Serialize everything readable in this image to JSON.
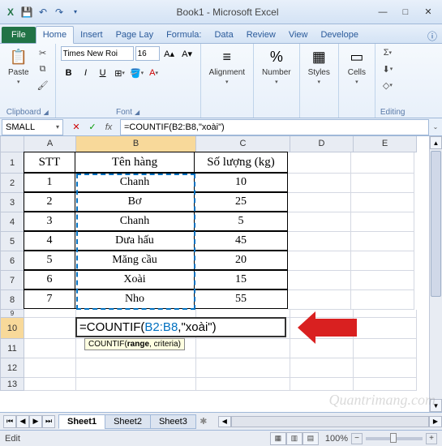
{
  "window": {
    "title": "Book1 - Microsoft Excel"
  },
  "qat": {
    "excel": "X",
    "save": "💾",
    "undo": "↶",
    "redo": "↷",
    "custom_dd": "▾"
  },
  "win": {
    "min": "—",
    "max": "□",
    "close": "✕"
  },
  "tabs": {
    "file": "File",
    "home": "Home",
    "insert": "Insert",
    "pagelayout": "Page Lay",
    "formulas": "Formula:",
    "data": "Data",
    "review": "Review",
    "view": "View",
    "developer": "Develope"
  },
  "ribbon": {
    "clipboard": {
      "label": "Clipboard",
      "paste": "Paste"
    },
    "font": {
      "label": "Font",
      "name": "Times New Roi",
      "size": "16",
      "bold": "B",
      "italic": "I",
      "underline": "U"
    },
    "alignment": {
      "label": "Alignment"
    },
    "number": {
      "label": "Number"
    },
    "styles": {
      "label": "Styles"
    },
    "cells": {
      "label": "Cells"
    },
    "editing": {
      "label": "Editing",
      "sum": "Σ",
      "fill": "⬇",
      "clear": "◇"
    }
  },
  "namebox": "SMALL",
  "formula_bar": {
    "cancel": "✕",
    "enter": "✓",
    "fx": "fx",
    "value": "=COUNTIF(B2:B8,\"xoài\")"
  },
  "columns": [
    "A",
    "B",
    "C",
    "D",
    "E"
  ],
  "table": {
    "headers": {
      "a": "STT",
      "b": "Tên hàng",
      "c": "Số lượng (kg)"
    },
    "rows": [
      {
        "stt": "1",
        "name": "Chanh",
        "qty": "10"
      },
      {
        "stt": "2",
        "name": "Bơ",
        "qty": "25"
      },
      {
        "stt": "3",
        "name": "Chanh",
        "qty": "5"
      },
      {
        "stt": "4",
        "name": "Dưa hấu",
        "qty": "45"
      },
      {
        "stt": "5",
        "name": "Măng cầu",
        "qty": "20"
      },
      {
        "stt": "6",
        "name": "Xoài",
        "qty": "15"
      },
      {
        "stt": "7",
        "name": "Nho",
        "qty": "55"
      }
    ]
  },
  "editing": {
    "prefix": "=COUNTIF(",
    "range": "B2:B8",
    "suffix": ",\"xoài\")",
    "tooltip_fn": "COUNTIF(",
    "tooltip_bold": "range",
    "tooltip_rest": ", criteria)"
  },
  "sheets": {
    "s1": "Sheet1",
    "s2": "Sheet2",
    "s3": "Sheet3"
  },
  "status": {
    "mode": "Edit",
    "zoom": "100%"
  },
  "watermark": "Quantrimang.com"
}
